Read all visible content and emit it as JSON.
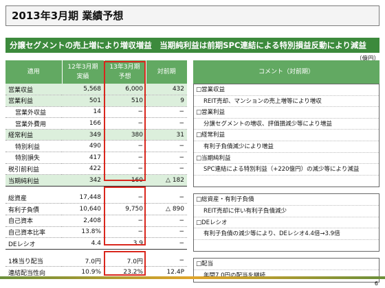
{
  "title": "2013年3月期 業績予想",
  "headline": "分譲セグメントの売上増により増収増益　当期純利益は前期SPC連結による特別損益反動により減益",
  "unit": "（億円）",
  "table": {
    "headers": [
      "適用",
      "12年3月期\n実績",
      "13年3月期\n予想",
      "対前期"
    ],
    "groups": [
      [
        {
          "label": "営業収益",
          "a": "5,568",
          "b": "6,000",
          "c": "432",
          "hl": true,
          "indent": false
        },
        {
          "label": "営業利益",
          "a": "501",
          "b": "510",
          "c": "9",
          "hl": true,
          "indent": false
        },
        {
          "label": "営業外収益",
          "a": "14",
          "b": "−",
          "c": "−",
          "hl": false,
          "indent": true
        },
        {
          "label": "営業外費用",
          "a": "166",
          "b": "−",
          "c": "−",
          "hl": false,
          "indent": true
        },
        {
          "label": "経常利益",
          "a": "349",
          "b": "380",
          "c": "31",
          "hl": true,
          "indent": false
        },
        {
          "label": "特別利益",
          "a": "490",
          "b": "−",
          "c": "−",
          "hl": false,
          "indent": true
        },
        {
          "label": "特別損失",
          "a": "417",
          "b": "−",
          "c": "−",
          "hl": false,
          "indent": true
        },
        {
          "label": "税引前利益",
          "a": "422",
          "b": "−",
          "c": "−",
          "hl": false,
          "indent": false
        },
        {
          "label": "当期純利益",
          "a": "342",
          "b": "160",
          "c": "△ 182",
          "hl": true,
          "indent": false
        }
      ],
      [
        {
          "label": "総資産",
          "a": "17,448",
          "b": "−",
          "c": "−",
          "hl": false,
          "indent": false
        },
        {
          "label": "有利子負債",
          "a": "10,640",
          "b": "9,750",
          "c": "△ 890",
          "hl": false,
          "indent": false
        },
        {
          "label": "自己資本",
          "a": "2,408",
          "b": "−",
          "c": "−",
          "hl": false,
          "indent": false
        },
        {
          "label": "自己資本比率",
          "a": "13.8%",
          "b": "−",
          "c": "−",
          "hl": false,
          "indent": false
        },
        {
          "label": "DEレシオ",
          "a": "4.4",
          "b": "3.9",
          "c": "−",
          "hl": false,
          "indent": false
        }
      ],
      [
        {
          "label": "1株当り配当",
          "a": "7.0円",
          "b": "7.0円",
          "c": "−",
          "hl": false,
          "indent": false
        },
        {
          "label": "連結配当性向",
          "a": "10.9%",
          "b": "23.2%",
          "c": "12.4P",
          "hl": false,
          "indent": false
        }
      ]
    ]
  },
  "comments": {
    "header": "コメント（対前期）",
    "groups": [
      [
        {
          "text": "□営業収益",
          "sub": false
        },
        {
          "text": "REIT売却、マンションの売上増等により増収",
          "sub": true
        },
        {
          "text": "□営業利益",
          "sub": false
        },
        {
          "text": "分譲セグメントの増収、評価損減少等により増益",
          "sub": true
        },
        {
          "text": "□経常利益",
          "sub": false
        },
        {
          "text": "有利子負債減少により増益",
          "sub": true
        },
        {
          "text": "□当期純利益",
          "sub": false
        },
        {
          "text": "SPC連結による特別利益（+220億円）の減少等により減益",
          "sub": true
        },
        {
          "text": "",
          "sub": false
        }
      ],
      [
        {
          "text": "□総資産・有利子負債",
          "sub": false
        },
        {
          "text": "REIT売却に伴い有利子負債減少",
          "sub": true
        },
        {
          "text": "□DEレシオ",
          "sub": false
        },
        {
          "text": "有利子負債の減少等により、DEレシオ4.4倍→3.9倍",
          "sub": true
        },
        {
          "text": "",
          "sub": false
        }
      ],
      [
        {
          "text": "□配当",
          "sub": false
        },
        {
          "text": "年間7.0円の配当を継続",
          "sub": true
        }
      ]
    ]
  },
  "page_number": "6",
  "colors": {
    "header_green": "#62a962",
    "headline_green": "#3c8a3c",
    "highlight": "#dcefdc",
    "red_box": "#d9261c"
  }
}
